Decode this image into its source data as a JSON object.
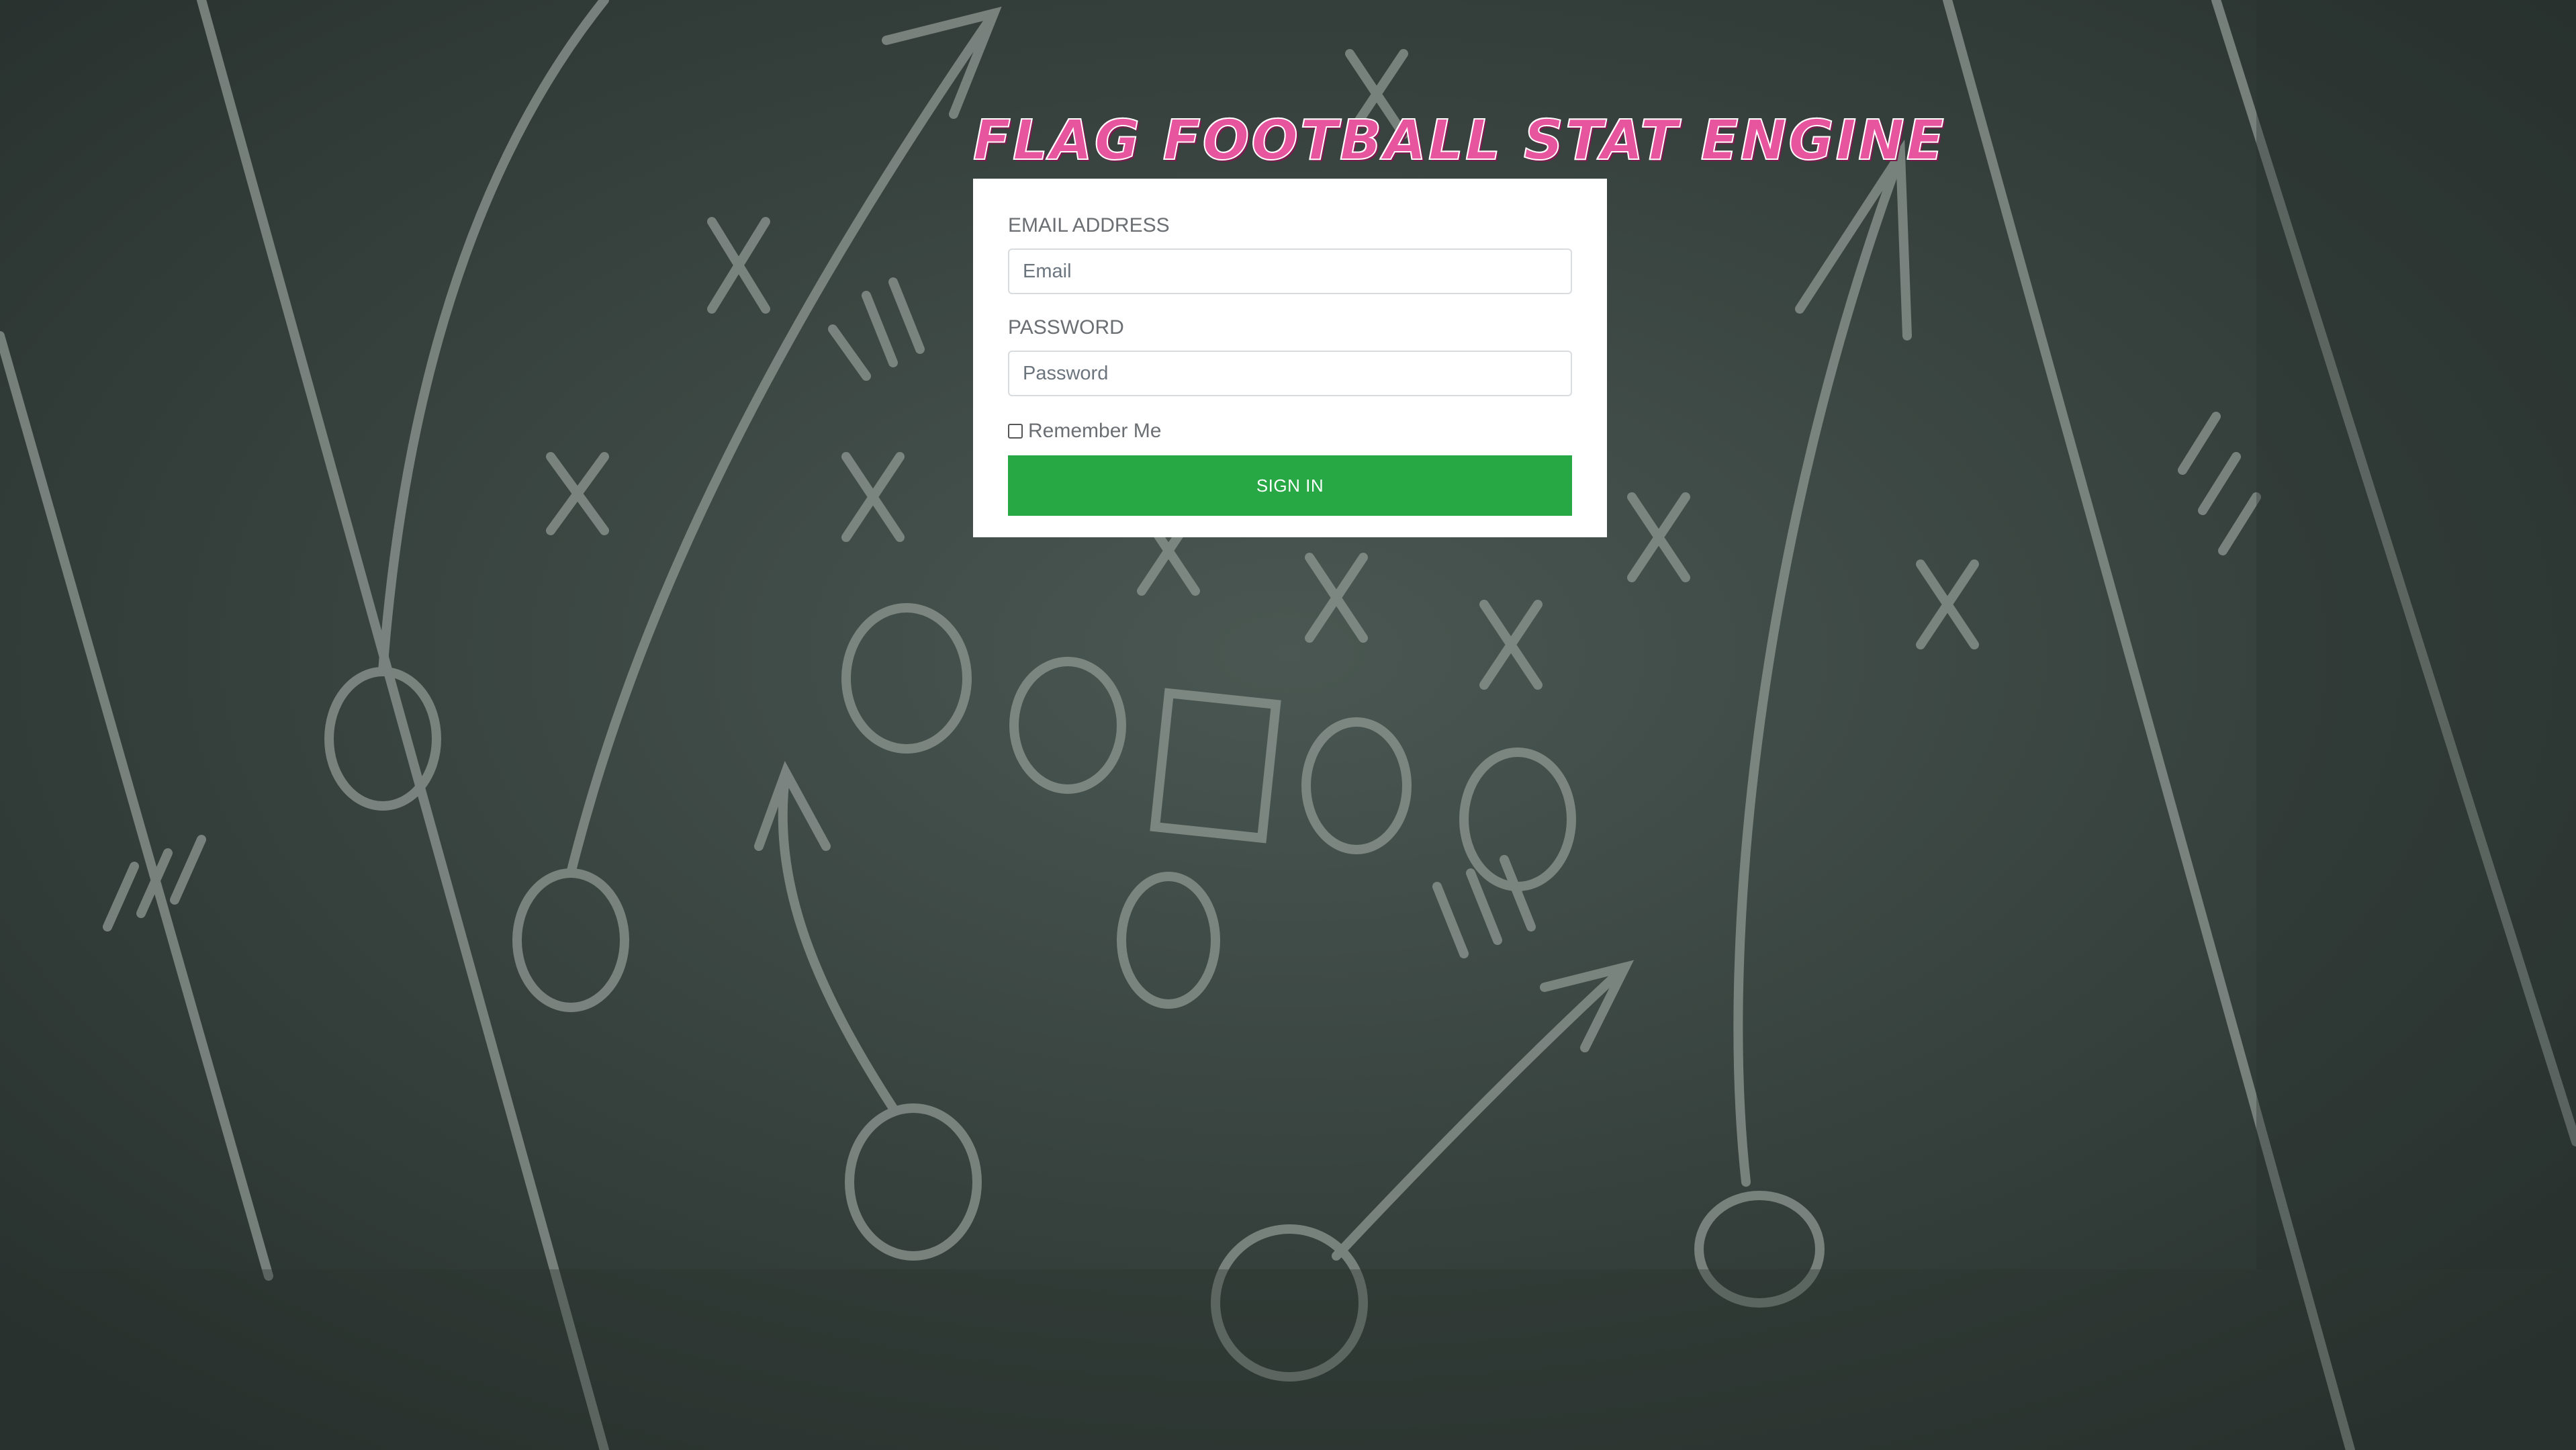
{
  "app": {
    "title": "FLAG FOOTBALL STAT ENGINE"
  },
  "form": {
    "email_label": "EMAIL ADDRESS",
    "email_placeholder": "Email",
    "email_value": "",
    "password_label": "PASSWORD",
    "password_placeholder": "Password",
    "password_value": "",
    "remember_label": "Remember Me",
    "remember_checked": false,
    "submit_label": "SIGN IN"
  },
  "colors": {
    "background": "#34403c",
    "chalk": "#9aa39e",
    "logo": "#e8559f",
    "submit": "#28a745",
    "card": "#ffffff"
  }
}
